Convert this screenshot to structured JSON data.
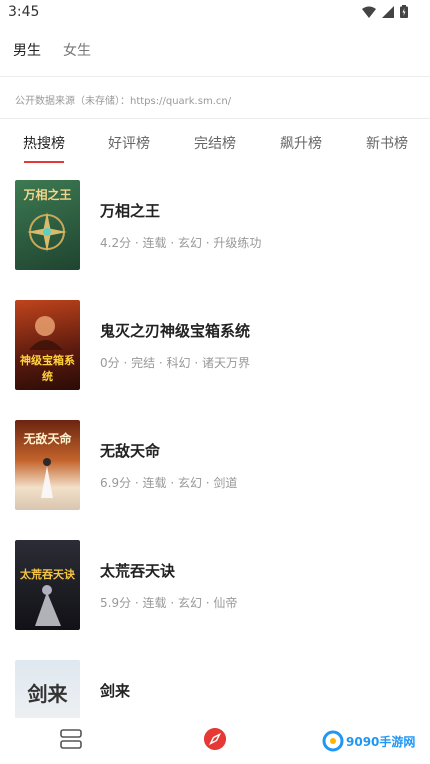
{
  "status_bar": {
    "time": "3:45"
  },
  "gender_tabs": [
    {
      "label": "男生",
      "active": true
    },
    {
      "label": "女生",
      "active": false
    }
  ],
  "source_note": "公开数据来源（未存储）：https://quark.sm.cn/",
  "rank_tabs": [
    {
      "label": "热搜榜",
      "active": true
    },
    {
      "label": "好评榜",
      "active": false
    },
    {
      "label": "完结榜",
      "active": false
    },
    {
      "label": "飙升榜",
      "active": false
    },
    {
      "label": "新书榜",
      "active": false
    }
  ],
  "books": [
    {
      "title": "万相之王",
      "meta": "4.2分 · 连载 · 玄幻 · 升级练功",
      "cover_text": "万相之王",
      "cover_color": "#2e5b3c"
    },
    {
      "title": "鬼灭之刃神级宝箱系统",
      "meta": "0分 · 完结 · 科幻 · 诸天万界",
      "cover_text": "神级宝箱系统",
      "cover_color": "#7a2a14"
    },
    {
      "title": "无敌天命",
      "meta": "6.9分 · 连载 · 玄幻 · 剑道",
      "cover_text": "无敌天命",
      "cover_color": "#8c3b1e"
    },
    {
      "title": "太荒吞天诀",
      "meta": "5.9分 · 连载 · 玄幻 · 仙帝",
      "cover_text": "太荒吞天诀",
      "cover_color": "#1e1e24"
    },
    {
      "title": "剑来",
      "meta": "",
      "cover_text": "剑来",
      "cover_color": "#eef0f2"
    }
  ],
  "watermark": {
    "text": "9090手游网"
  }
}
